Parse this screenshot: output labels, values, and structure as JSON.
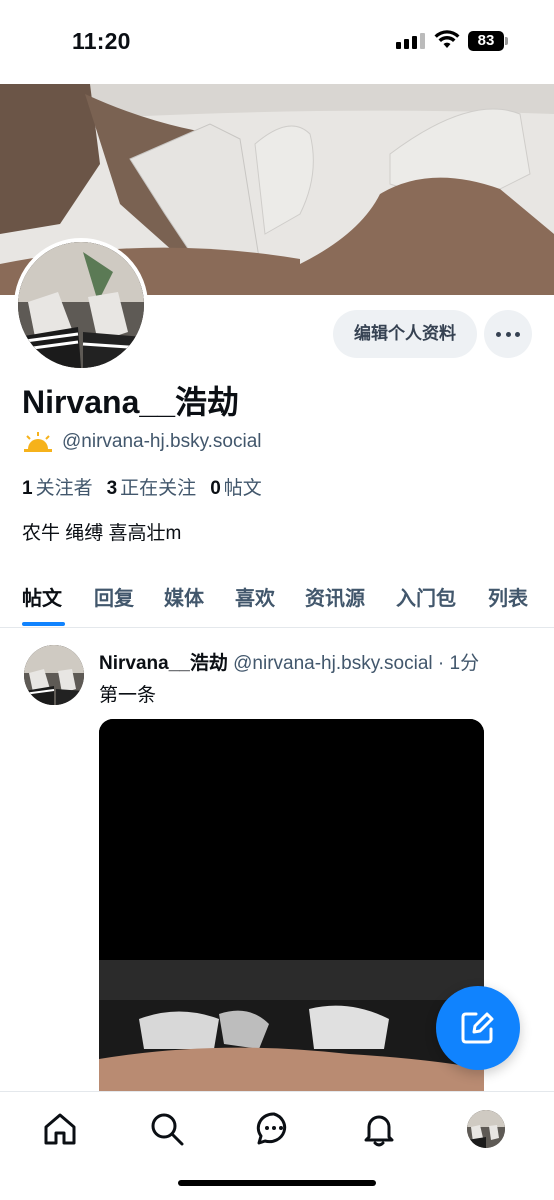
{
  "status_bar": {
    "time": "11:20",
    "battery": "83"
  },
  "profile": {
    "display_name": "Nirvana__浩劫",
    "handle": "@nirvana-hj.bsky.social",
    "edit_label": "编辑个人资料",
    "stats": {
      "followers_count": "1",
      "followers_label": "关注者",
      "following_count": "3",
      "following_label": "正在关注",
      "posts_count": "0",
      "posts_label": "帖文"
    },
    "bio": "农牛 绳缚 喜高壮m"
  },
  "tabs": [
    {
      "label": "帖文",
      "active": true
    },
    {
      "label": "回复"
    },
    {
      "label": "媒体"
    },
    {
      "label": "喜欢"
    },
    {
      "label": "资讯源"
    },
    {
      "label": "入门包"
    },
    {
      "label": "列表"
    }
  ],
  "post": {
    "author_name": "Nirvana__浩劫",
    "author_meta": "@nirvana-hj.bsky.social · 1分",
    "text": "第一条"
  },
  "bottom_nav": [
    "home-icon",
    "search-icon",
    "chat-icon",
    "bell-icon",
    "profile-avatar"
  ],
  "colors": {
    "accent": "#1083fe",
    "muted_text": "#42576c",
    "button_bg": "#eef1f4"
  }
}
